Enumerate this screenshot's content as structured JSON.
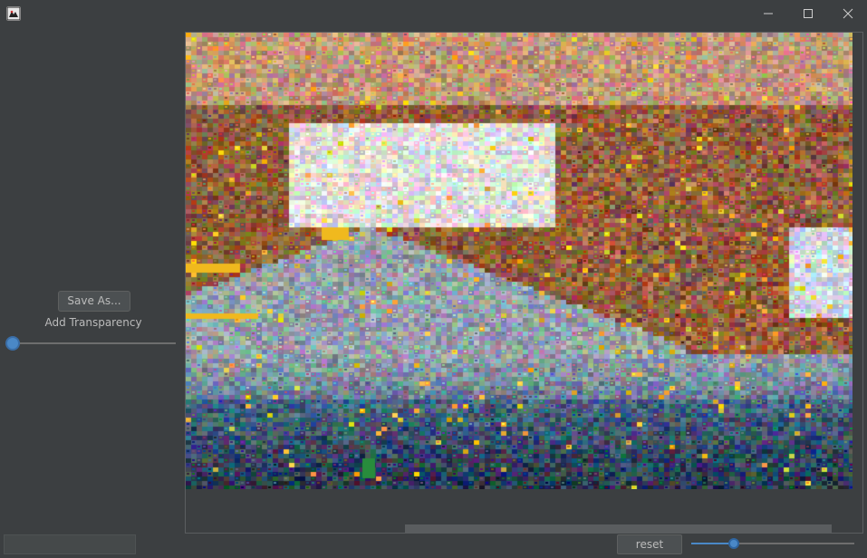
{
  "window": {
    "title": ""
  },
  "left_panel": {
    "save_label": "Save As...",
    "transparency_label": "Add Transparency",
    "transparency_value": 0,
    "bottom_field_value": ""
  },
  "bottom_bar": {
    "reset_label": "reset",
    "zoom_value": 0.26
  },
  "image": {
    "description_icon": "mosaic-image"
  },
  "colors": {
    "background": "#3c3f41",
    "accent": "#4a88c7",
    "text": "#bbbbbb"
  }
}
